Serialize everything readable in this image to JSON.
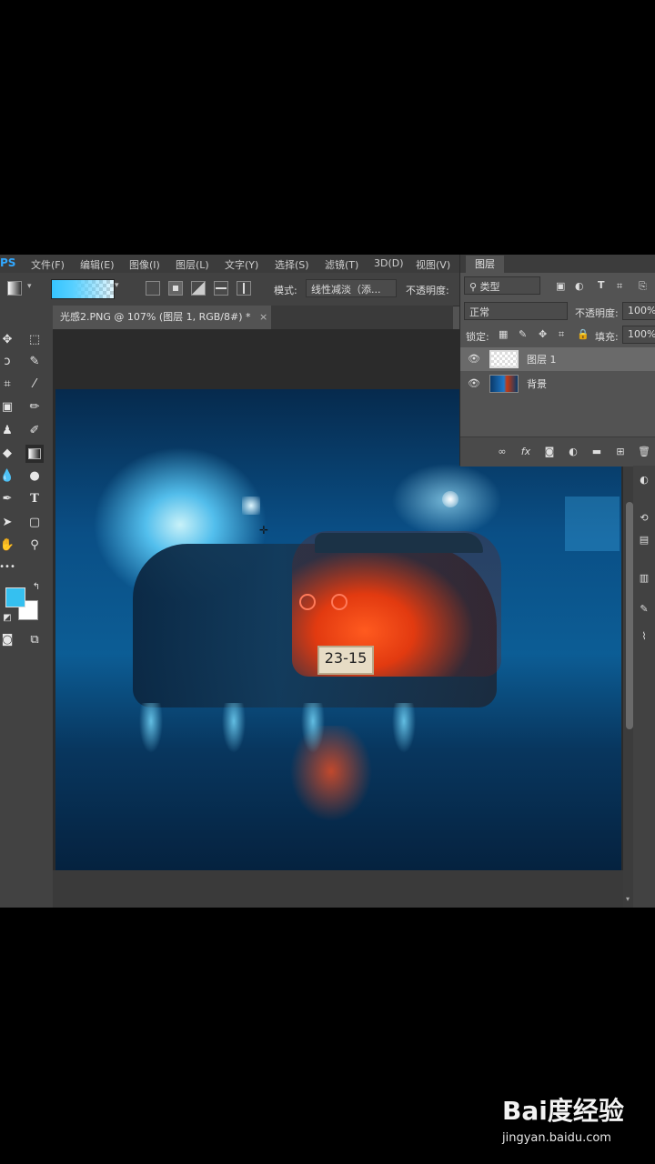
{
  "app": {
    "logo": "PS",
    "menu": [
      "文件(F)",
      "编辑(E)",
      "图像(I)",
      "图层(L)",
      "文字(Y)",
      "选择(S)",
      "滤镜(T)",
      "3D(D)",
      "视图(V)"
    ]
  },
  "options": {
    "mode_label": "模式:",
    "mode_value": "线性减淡（添...",
    "opacity_label": "不透明度:"
  },
  "document": {
    "tab_title": "光感2.PNG @ 107% (图层 1, RGB/8#) *",
    "close": "×",
    "plate_text": "23-15"
  },
  "colors": {
    "foreground": "#35c0f0",
    "background": "#ffffff",
    "accent": "#31a8ff"
  },
  "layers_panel": {
    "tab": "图层",
    "filter_label": "类型",
    "blend_mode": "正常",
    "opacity_label": "不透明度:",
    "opacity_value": "100%",
    "lock_label": "锁定:",
    "fill_label": "填充:",
    "fill_value": "100%",
    "layers": [
      {
        "name": "图层 1",
        "visible": true,
        "selected": true
      },
      {
        "name": "背景",
        "visible": true,
        "selected": false
      }
    ]
  },
  "watermark": {
    "logo": "Bai度经验",
    "url": "jingyan.baidu.com"
  }
}
